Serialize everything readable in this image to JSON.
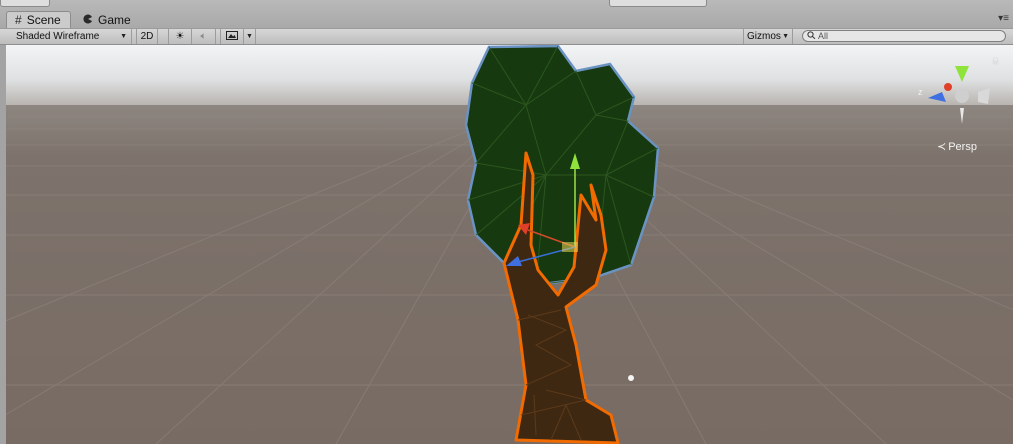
{
  "tabs": {
    "scene": {
      "label": "Scene",
      "icon": "grid-icon"
    },
    "game": {
      "label": "Game",
      "icon": "pacman-icon"
    }
  },
  "toolbar": {
    "draw_mode": "Shaded Wireframe",
    "two_d": "2D",
    "gizmos": "Gizmos",
    "search_placeholder": "All"
  },
  "scene": {
    "projection_label": "Persp",
    "gizmo_axis_z": "z",
    "colors": {
      "sky": "#dfe2e4",
      "ground": "#7a6f69",
      "foliage": "#17390f",
      "trunk": "#3f2812",
      "selection_outline": "#f26b00",
      "hover_outline": "#6a93c4"
    }
  }
}
